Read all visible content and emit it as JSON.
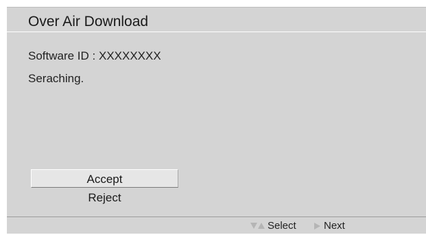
{
  "dialog": {
    "title": "Over Air Download",
    "software_id": "Software ID : XXXXXXXX",
    "status": "Seraching.",
    "options": [
      {
        "label": "Accept",
        "selected": true
      },
      {
        "label": "Reject",
        "selected": false
      }
    ]
  },
  "footer": {
    "select_hint": "Select",
    "next_hint": "Next",
    "icons": [
      "arrow-down-icon",
      "arrow-up-icon",
      "arrow-right-icon"
    ]
  },
  "colors": {
    "panel_background": "#d4d4d4",
    "selected_option_background": "#e6e6e6",
    "arrow_icon": "#b5b5b5",
    "text": "#1a1a1a"
  }
}
